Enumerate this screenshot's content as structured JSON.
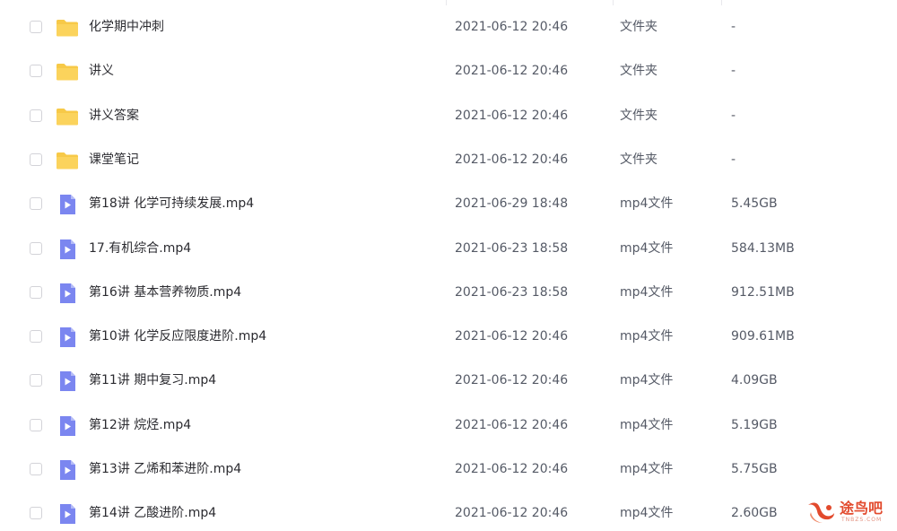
{
  "files": [
    {
      "name": "化学期中冲刺",
      "date": "2021-06-12 20:46",
      "type": "文件夹",
      "size": "-",
      "icon": "folder-icon"
    },
    {
      "name": "讲义",
      "date": "2021-06-12 20:46",
      "type": "文件夹",
      "size": "-",
      "icon": "folder-icon"
    },
    {
      "name": "讲义答案",
      "date": "2021-06-12 20:46",
      "type": "文件夹",
      "size": "-",
      "icon": "folder-icon"
    },
    {
      "name": "课堂笔记",
      "date": "2021-06-12 20:46",
      "type": "文件夹",
      "size": "-",
      "icon": "folder-icon"
    },
    {
      "name": "第18讲 化学可持续发展.mp4",
      "date": "2021-06-29 18:48",
      "type": "mp4文件",
      "size": "5.45GB",
      "icon": "video-file-icon"
    },
    {
      "name": "17.有机综合.mp4",
      "date": "2021-06-23 18:58",
      "type": "mp4文件",
      "size": "584.13MB",
      "icon": "video-file-icon"
    },
    {
      "name": "第16讲 基本营养物质.mp4",
      "date": "2021-06-23 18:58",
      "type": "mp4文件",
      "size": "912.51MB",
      "icon": "video-file-icon"
    },
    {
      "name": "第10讲 化学反应限度进阶.mp4",
      "date": "2021-06-12 20:46",
      "type": "mp4文件",
      "size": "909.61MB",
      "icon": "video-file-icon"
    },
    {
      "name": "第11讲 期中复习.mp4",
      "date": "2021-06-12 20:46",
      "type": "mp4文件",
      "size": "4.09GB",
      "icon": "video-file-icon"
    },
    {
      "name": "第12讲 烷烃.mp4",
      "date": "2021-06-12 20:46",
      "type": "mp4文件",
      "size": "5.19GB",
      "icon": "video-file-icon"
    },
    {
      "name": "第13讲 乙烯和苯进阶.mp4",
      "date": "2021-06-12 20:46",
      "type": "mp4文件",
      "size": "5.75GB",
      "icon": "video-file-icon"
    },
    {
      "name": "第14讲 乙酸进阶.mp4",
      "date": "2021-06-12 20:46",
      "type": "mp4文件",
      "size": "2.60GB",
      "icon": "video-file-icon"
    }
  ],
  "colors": {
    "folder": "#f7c948",
    "video": "#7b86f0",
    "text": "#2b2b30",
    "muted": "#555a66",
    "watermark": "#e24a2d"
  },
  "watermark": {
    "text": "途鸟吧",
    "sub": "TNBZS.COM"
  }
}
